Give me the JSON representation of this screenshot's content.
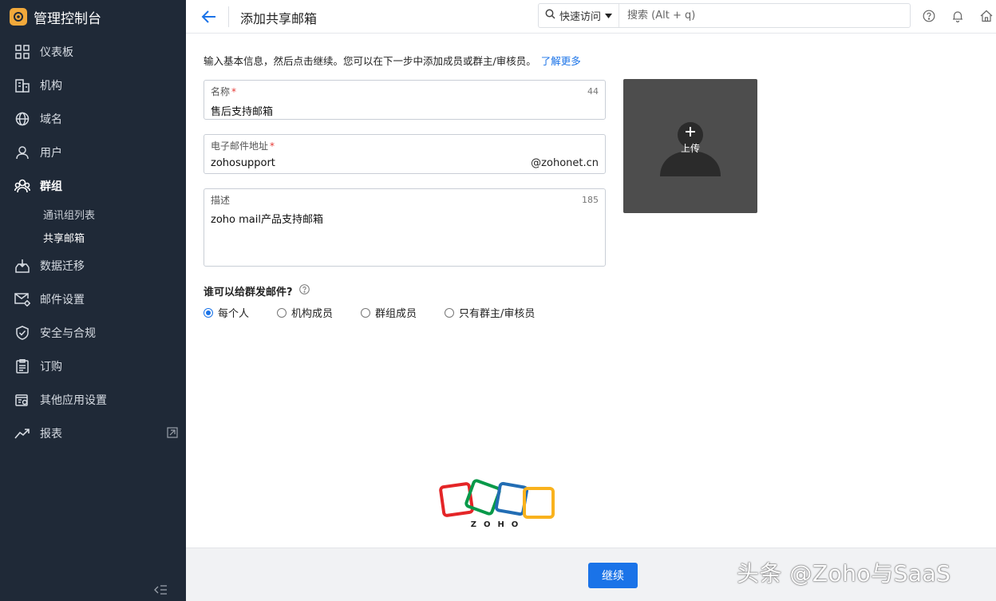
{
  "app": {
    "title": "管理控制台"
  },
  "sidebar": {
    "items": [
      {
        "label": "仪表板",
        "icon": "dashboard-icon"
      },
      {
        "label": "机构",
        "icon": "organization-icon"
      },
      {
        "label": "域名",
        "icon": "globe-icon"
      },
      {
        "label": "用户",
        "icon": "user-icon"
      },
      {
        "label": "群组",
        "icon": "group-icon"
      },
      {
        "label": "数据迁移",
        "icon": "migration-icon"
      },
      {
        "label": "邮件设置",
        "icon": "mail-settings-icon"
      },
      {
        "label": "安全与合规",
        "icon": "shield-icon"
      },
      {
        "label": "订购",
        "icon": "subscription-icon"
      },
      {
        "label": "其他应用设置",
        "icon": "apps-settings-icon"
      },
      {
        "label": "报表",
        "icon": "reports-icon"
      }
    ],
    "group_sub": [
      {
        "label": "通讯组列表"
      },
      {
        "label": "共享邮箱"
      }
    ]
  },
  "header": {
    "title": "添加共享邮箱",
    "quick_access": "快速访问",
    "search_placeholder": "搜索 (Alt + q)"
  },
  "form": {
    "intro": "输入基本信息，然后点击继续。您可以在下一步中添加成员或群主/审核员。",
    "learn_more": "了解更多",
    "name": {
      "label": "名称",
      "value": "售后支持邮箱",
      "counter": "44"
    },
    "email": {
      "label": "电子邮件地址",
      "value": "zohosupport",
      "domain": "@zohonet.cn"
    },
    "description": {
      "label": "描述",
      "value": "zoho mail产品支持邮箱",
      "counter": "185"
    },
    "upload_label": "上传",
    "who_can_send": "谁可以给群发邮件?",
    "options": [
      {
        "label": "每个人",
        "checked": true
      },
      {
        "label": "机构成员",
        "checked": false
      },
      {
        "label": "群组成员",
        "checked": false
      },
      {
        "label": "只有群主/审核员",
        "checked": false
      }
    ]
  },
  "footer": {
    "continue_label": "继续",
    "logo_text": "ZOHO",
    "watermark": "头条 @Zoho与SaaS"
  },
  "colors": {
    "sidebar_bg": "#1f2937",
    "accent": "#1a73e8",
    "upload_bg": "#4d4d4d"
  }
}
